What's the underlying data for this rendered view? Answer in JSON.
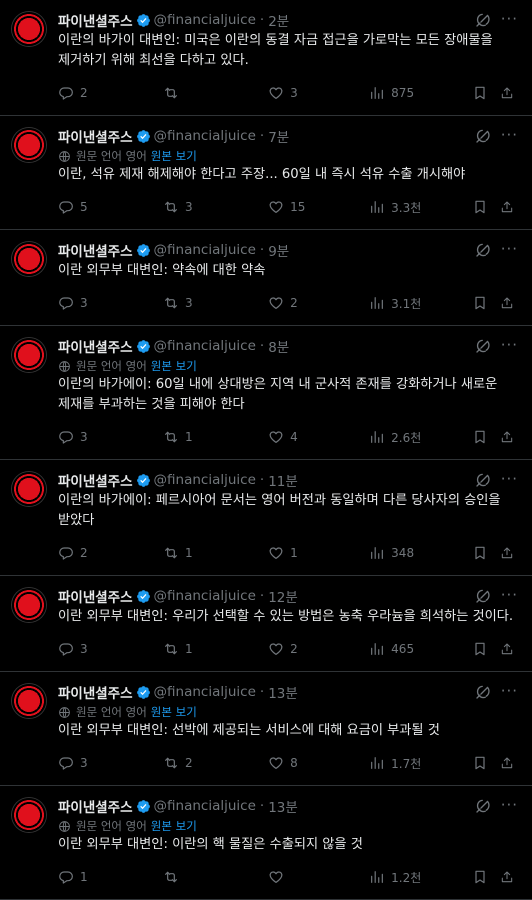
{
  "tweets": [
    {
      "name": "파이낸셜주스",
      "handle": "@financialjuice",
      "time": "2분",
      "translated": false,
      "text": "이란의 바가이 대변인: 미국은 이란의 동결 자금 접근을 가로막는 모든 장애물을 제거하기 위해 최선을 다하고 있다.",
      "replies": "2",
      "retweets": "",
      "likes": "3",
      "views": "875"
    },
    {
      "name": "파이낸셜주스",
      "handle": "@financialjuice",
      "time": "7분",
      "translated": true,
      "text": "이란, 석유 제재 해제해야 한다고 주장... 60일 내 즉시 석유 수출 개시해야",
      "replies": "5",
      "retweets": "3",
      "likes": "15",
      "views": "3.3천"
    },
    {
      "name": "파이낸셜주스",
      "handle": "@financialjuice",
      "time": "9분",
      "translated": false,
      "text": "이란 외무부 대변인: 약속에 대한 약속",
      "replies": "3",
      "retweets": "3",
      "likes": "2",
      "views": "3.1천"
    },
    {
      "name": "파이낸셜주스",
      "handle": "@financialjuice",
      "time": "8분",
      "translated": true,
      "text": "이란의 바가에이: 60일 내에 상대방은 지역 내 군사적 존재를 강화하거나 새로운 제재를 부과하는 것을 피해야 한다",
      "replies": "3",
      "retweets": "1",
      "likes": "4",
      "views": "2.6천"
    },
    {
      "name": "파이낸셜주스",
      "handle": "@financialjuice",
      "time": "11분",
      "translated": false,
      "text": "이란의 바가에이: 페르시아어 문서는 영어 버전과 동일하며 다른 당사자의 승인을 받았다",
      "replies": "2",
      "retweets": "1",
      "likes": "1",
      "views": "348"
    },
    {
      "name": "파이낸셜주스",
      "handle": "@financialjuice",
      "time": "12분",
      "translated": false,
      "text": "이란 외무부 대변인: 우리가 선택할 수 있는 방법은 농축 우라늄을 희석하는 것이다.",
      "replies": "3",
      "retweets": "1",
      "likes": "2",
      "views": "465"
    },
    {
      "name": "파이낸셜주스",
      "handle": "@financialjuice",
      "time": "13분",
      "translated": true,
      "text": "이란 외무부 대변인: 선박에 제공되는 서비스에 대해 요금이 부과될 것",
      "replies": "3",
      "retweets": "2",
      "likes": "8",
      "views": "1.7천"
    },
    {
      "name": "파이낸셜주스",
      "handle": "@financialjuice",
      "time": "13분",
      "translated": true,
      "text": "이란 외무부 대변인: 이란의 핵 물질은 수출되지 않을 것",
      "replies": "1",
      "retweets": "",
      "likes": "",
      "views": "1.2천"
    }
  ],
  "translation": {
    "label": "원문 언어 영어",
    "show_original": "원본 보기"
  },
  "colors": {
    "background": "#000000",
    "text": "#e7e9ea",
    "muted": "#71767b",
    "accent": "#1d9bf0",
    "divider": "#2f3336",
    "avatar": "#e0101c"
  },
  "icons": [
    "verified-badge-icon",
    "grok-icon",
    "more-icon",
    "globe-icon",
    "reply-icon",
    "retweet-icon",
    "like-icon",
    "views-icon",
    "bookmark-icon",
    "share-icon"
  ]
}
